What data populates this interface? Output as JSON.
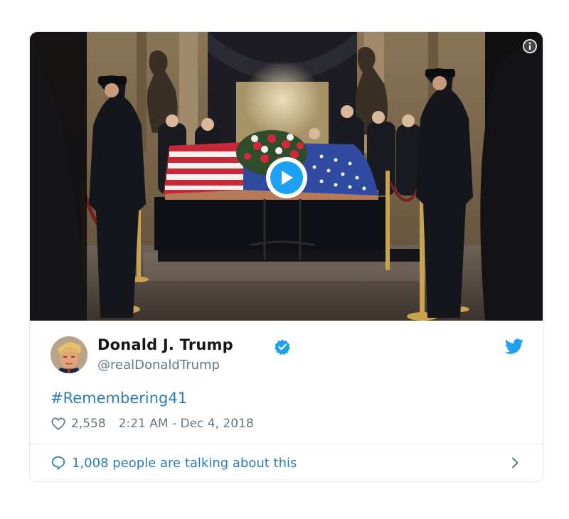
{
  "tweet": {
    "author_name": "Donald J. Trump",
    "author_handle": "@realDonaldTrump",
    "text": "#Remembering41",
    "likes": "2,558",
    "timestamp": "2:21 AM - Dec 4, 2018",
    "conversation_label": "1,008 people are talking about this"
  },
  "media": {
    "type": "video",
    "play_icon": "play-icon",
    "info_icon": "info-icon"
  },
  "icons": {
    "verified": "verified-badge-icon",
    "brand": "twitter-bird-icon",
    "like": "heart-icon",
    "reply": "speech-bubble-icon",
    "more": "chevron-right-icon"
  },
  "colors": {
    "brand_blue": "#1da1f2",
    "link_blue": "#2b7bb9",
    "name_text": "#14171a",
    "secondary_text": "#657786",
    "border": "#e1e8ed"
  }
}
